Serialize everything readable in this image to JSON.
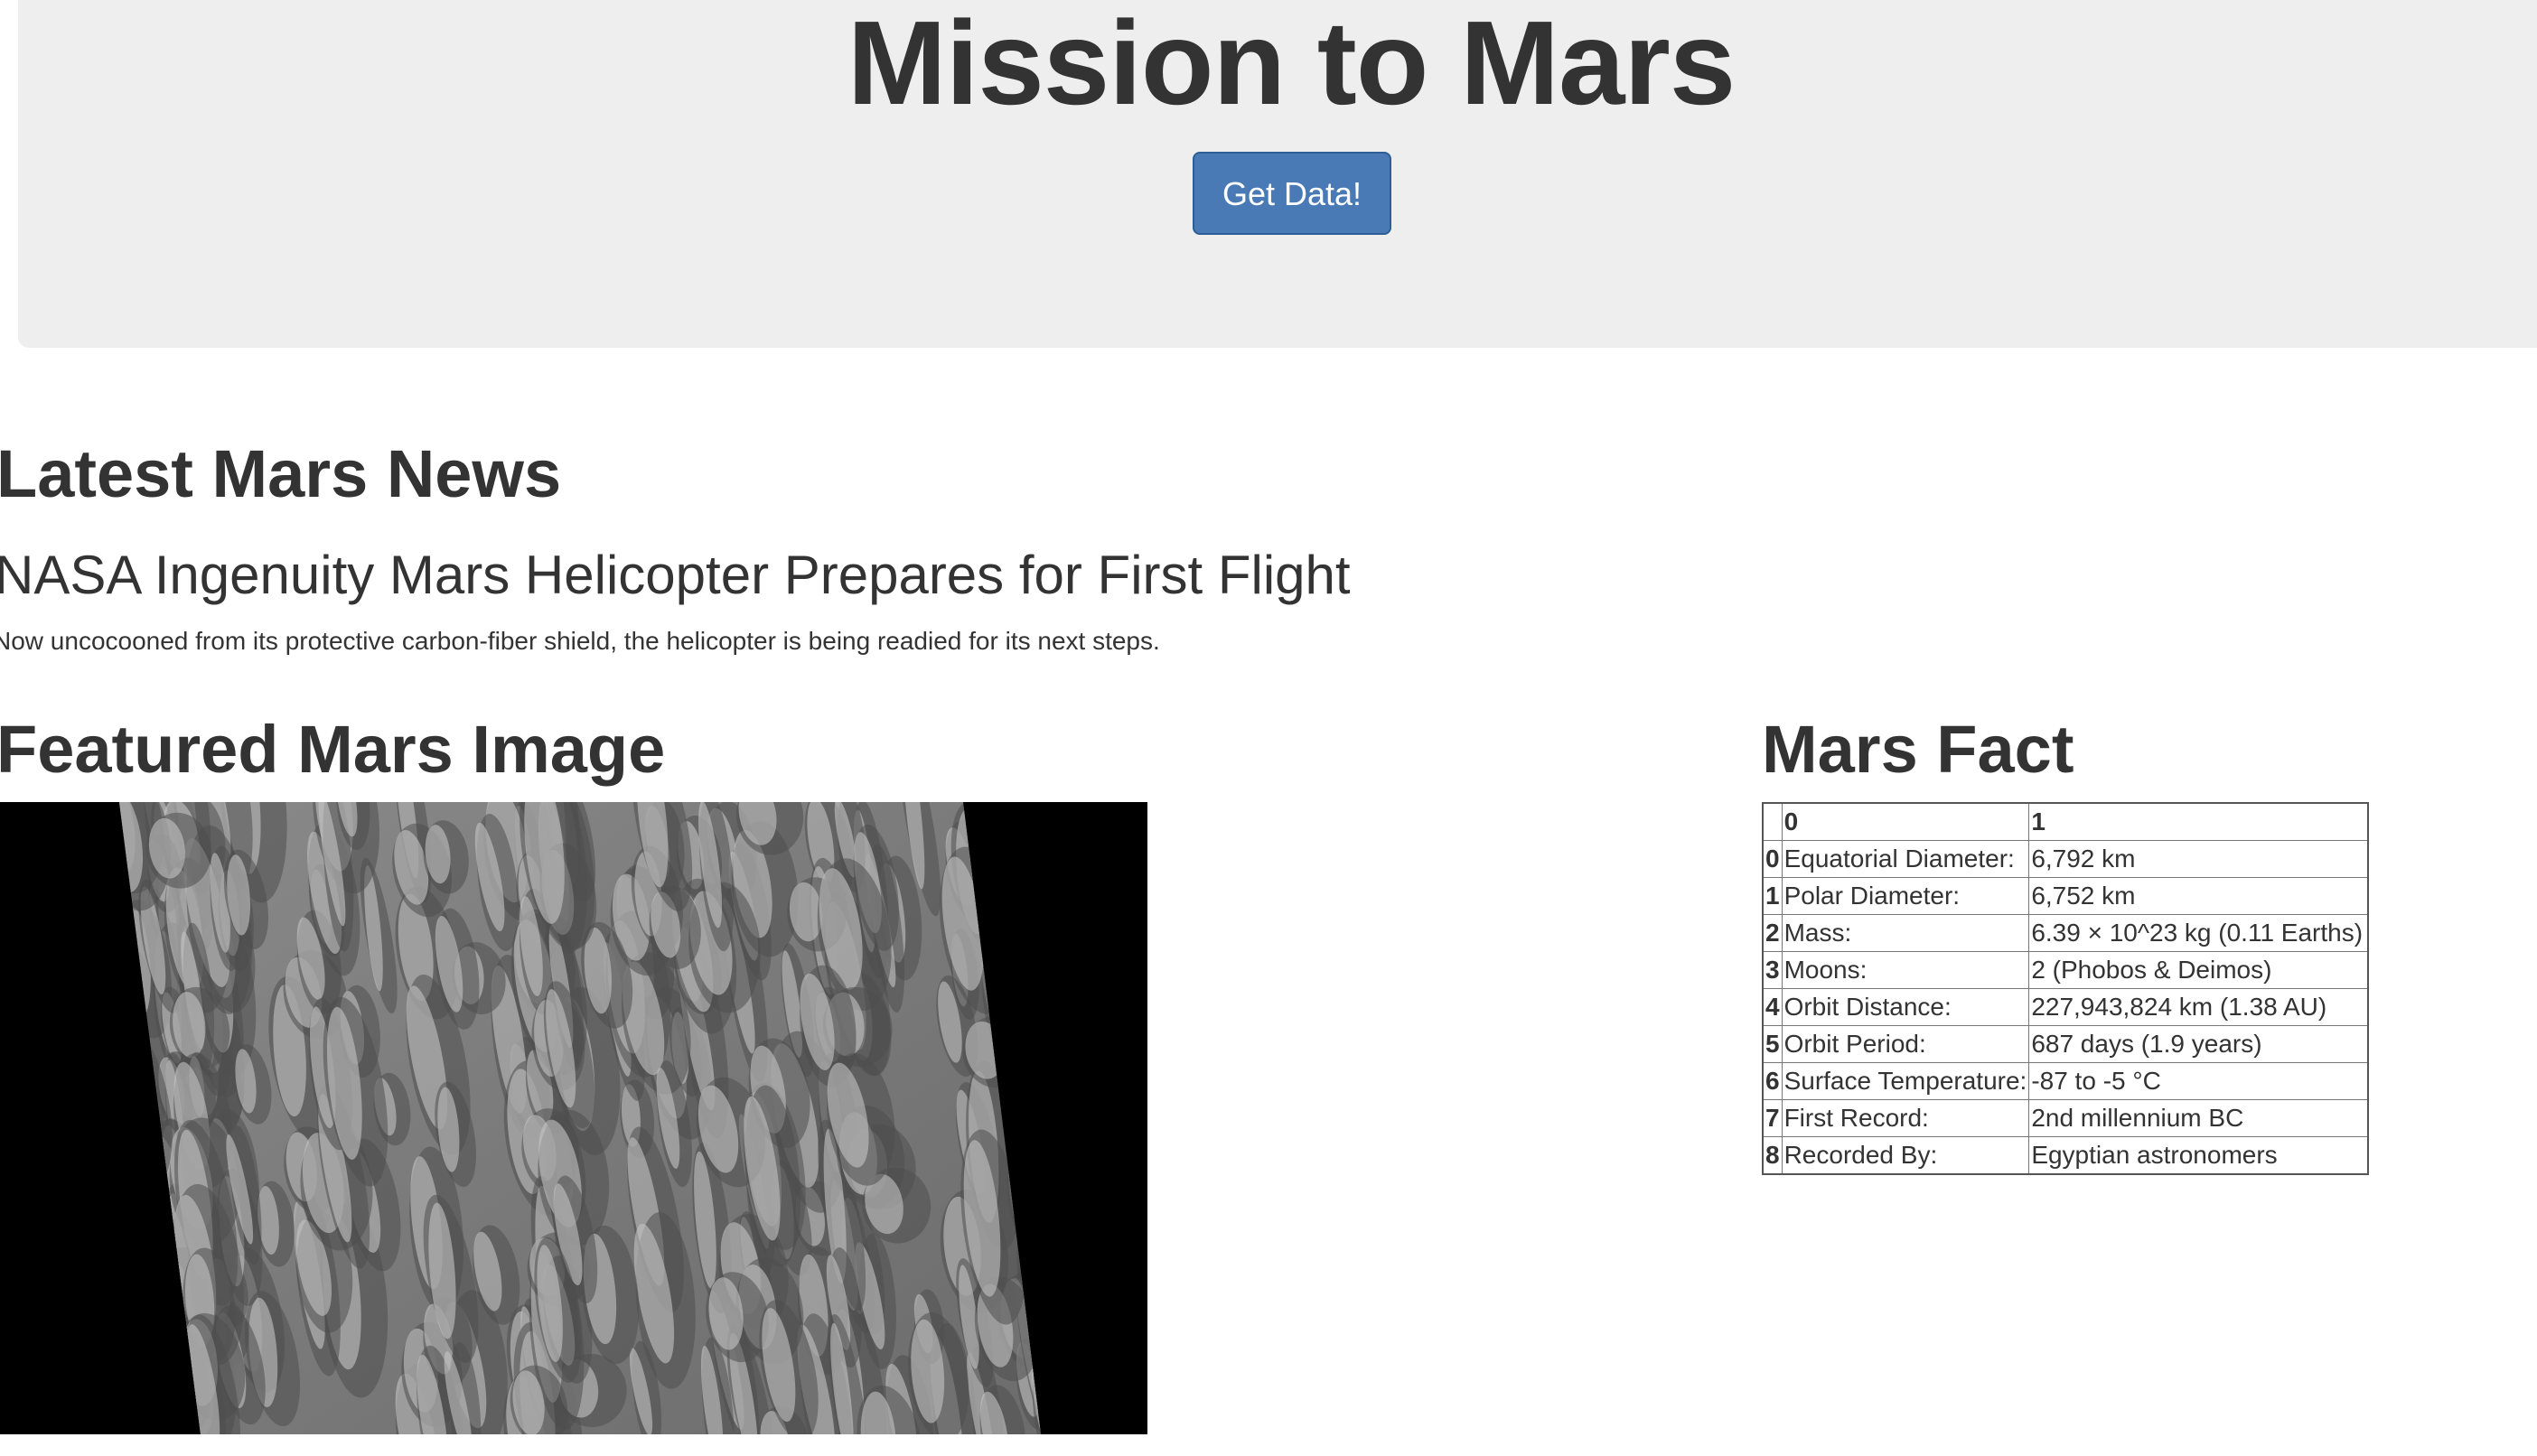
{
  "hero": {
    "title": "Mission to Mars",
    "button_label": "Get Data!",
    "button_color": "#4a7ab5"
  },
  "news": {
    "section_title": "Latest Mars News",
    "headline": "NASA Ingenuity Mars Helicopter Prepares for First Flight",
    "teaser": "Now uncocooned from its protective carbon-fiber shield, the helicopter is being readied for its next steps."
  },
  "featured_image": {
    "section_title": "Featured Mars Image"
  },
  "facts": {
    "section_title": "Mars Fact",
    "header": [
      "",
      "0",
      "1"
    ],
    "rows": [
      {
        "index": "0",
        "label": "Equatorial Diameter:",
        "value": "6,792 km"
      },
      {
        "index": "1",
        "label": "Polar Diameter:",
        "value": "6,752 km"
      },
      {
        "index": "2",
        "label": "Mass:",
        "value": "6.39 × 10^23 kg (0.11 Earths)"
      },
      {
        "index": "3",
        "label": "Moons:",
        "value": "2 (Phobos & Deimos)"
      },
      {
        "index": "4",
        "label": "Orbit Distance:",
        "value": "227,943,824 km (1.38 AU)"
      },
      {
        "index": "5",
        "label": "Orbit Period:",
        "value": "687 days (1.9 years)"
      },
      {
        "index": "6",
        "label": "Surface Temperature:",
        "value": "-87 to -5 °C"
      },
      {
        "index": "7",
        "label": "First Record:",
        "value": "2nd millennium BC"
      },
      {
        "index": "8",
        "label": "Recorded By:",
        "value": "Egyptian astronomers"
      }
    ]
  }
}
